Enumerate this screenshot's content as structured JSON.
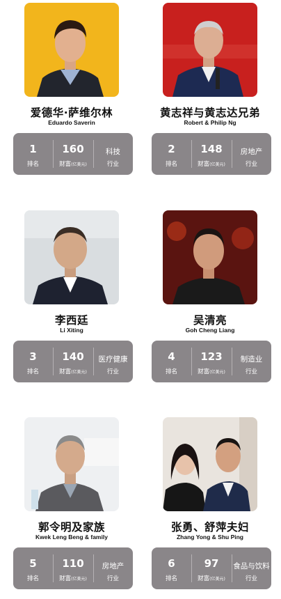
{
  "labels": {
    "rank": "排名",
    "wealth": "财富",
    "wealth_unit": "(亿美元)",
    "industry": "行业"
  },
  "people": [
    {
      "name_cn": "爱德华·萨维尔林",
      "name_en": "Eduardo Saverin",
      "rank": "1",
      "wealth": "160",
      "industry": "科技"
    },
    {
      "name_cn": "黄志祥与黄志达兄弟",
      "name_en": "Robert & Philip Ng",
      "rank": "2",
      "wealth": "148",
      "industry": "房地产"
    },
    {
      "name_cn": "李西廷",
      "name_en": "Li Xiting",
      "rank": "3",
      "wealth": "140",
      "industry": "医疗健康"
    },
    {
      "name_cn": "吴清亮",
      "name_en": "Goh Cheng Liang",
      "rank": "4",
      "wealth": "123",
      "industry": "制造业"
    },
    {
      "name_cn": "郭令明及家族",
      "name_en": "Kwek Leng Beng & family",
      "rank": "5",
      "wealth": "110",
      "industry": "房地产"
    },
    {
      "name_cn": "张勇、舒萍夫妇",
      "name_en": "Zhang Yong & Shu Ping",
      "rank": "6",
      "wealth": "97",
      "industry": "食品与饮料"
    }
  ],
  "colors": {
    "stats_bg": "#8a8689",
    "photo1_bg": "#f2b51c",
    "photo2_bg": "#c8201e"
  }
}
